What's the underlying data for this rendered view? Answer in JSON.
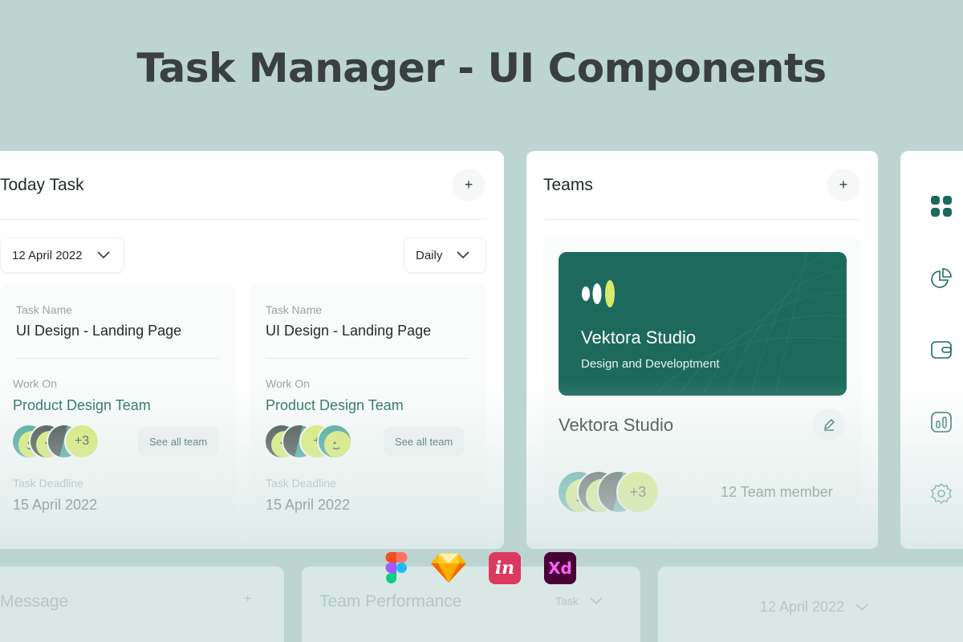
{
  "hero": {
    "title": "Task Manager - UI Components"
  },
  "today_task": {
    "title": "Today Task",
    "add_label": "+",
    "date_select": "12 April 2022",
    "period_select": "Daily",
    "tasks": [
      {
        "task_name_label": "Task Name",
        "task_name": "UI Design - Landing Page",
        "work_on_label": "Work On",
        "team": "Product Design Team",
        "more_count": "+3",
        "see_all": "See all team",
        "deadline_label": "Task Deadline",
        "deadline": "15 April 2022"
      },
      {
        "task_name_label": "Task Name",
        "task_name": "UI Design - Landing Page",
        "work_on_label": "Work On",
        "team": "Product Design Team",
        "more_count": "+",
        "see_all": "See all team",
        "deadline_label": "Task Deadline",
        "deadline": "15 April 2022"
      }
    ]
  },
  "teams": {
    "title": "Teams",
    "add_label": "+",
    "banner_name": "Vektora Studio",
    "banner_sub": "Design and Developtment",
    "studio_name": "Vektora Studio",
    "more_count": "+3",
    "member_count": "12 Team member"
  },
  "sidebar_icons": [
    "grid-icon",
    "pie-chart-icon",
    "wallet-icon",
    "bar-chart-icon",
    "settings-icon"
  ],
  "bottom": {
    "message": "Message",
    "message_add": "+",
    "performance": "Team Performance",
    "performance_select": "Task",
    "date": "12 April 2022"
  },
  "tools": [
    "figma-icon",
    "sketch-icon",
    "invision-icon",
    "xd-icon"
  ],
  "tool_labels": {
    "invision": "in",
    "xd": "Xd"
  },
  "colors": {
    "accent": "#1d6a5d",
    "lime": "#d7ea6b",
    "background": "#bcd5d1"
  }
}
